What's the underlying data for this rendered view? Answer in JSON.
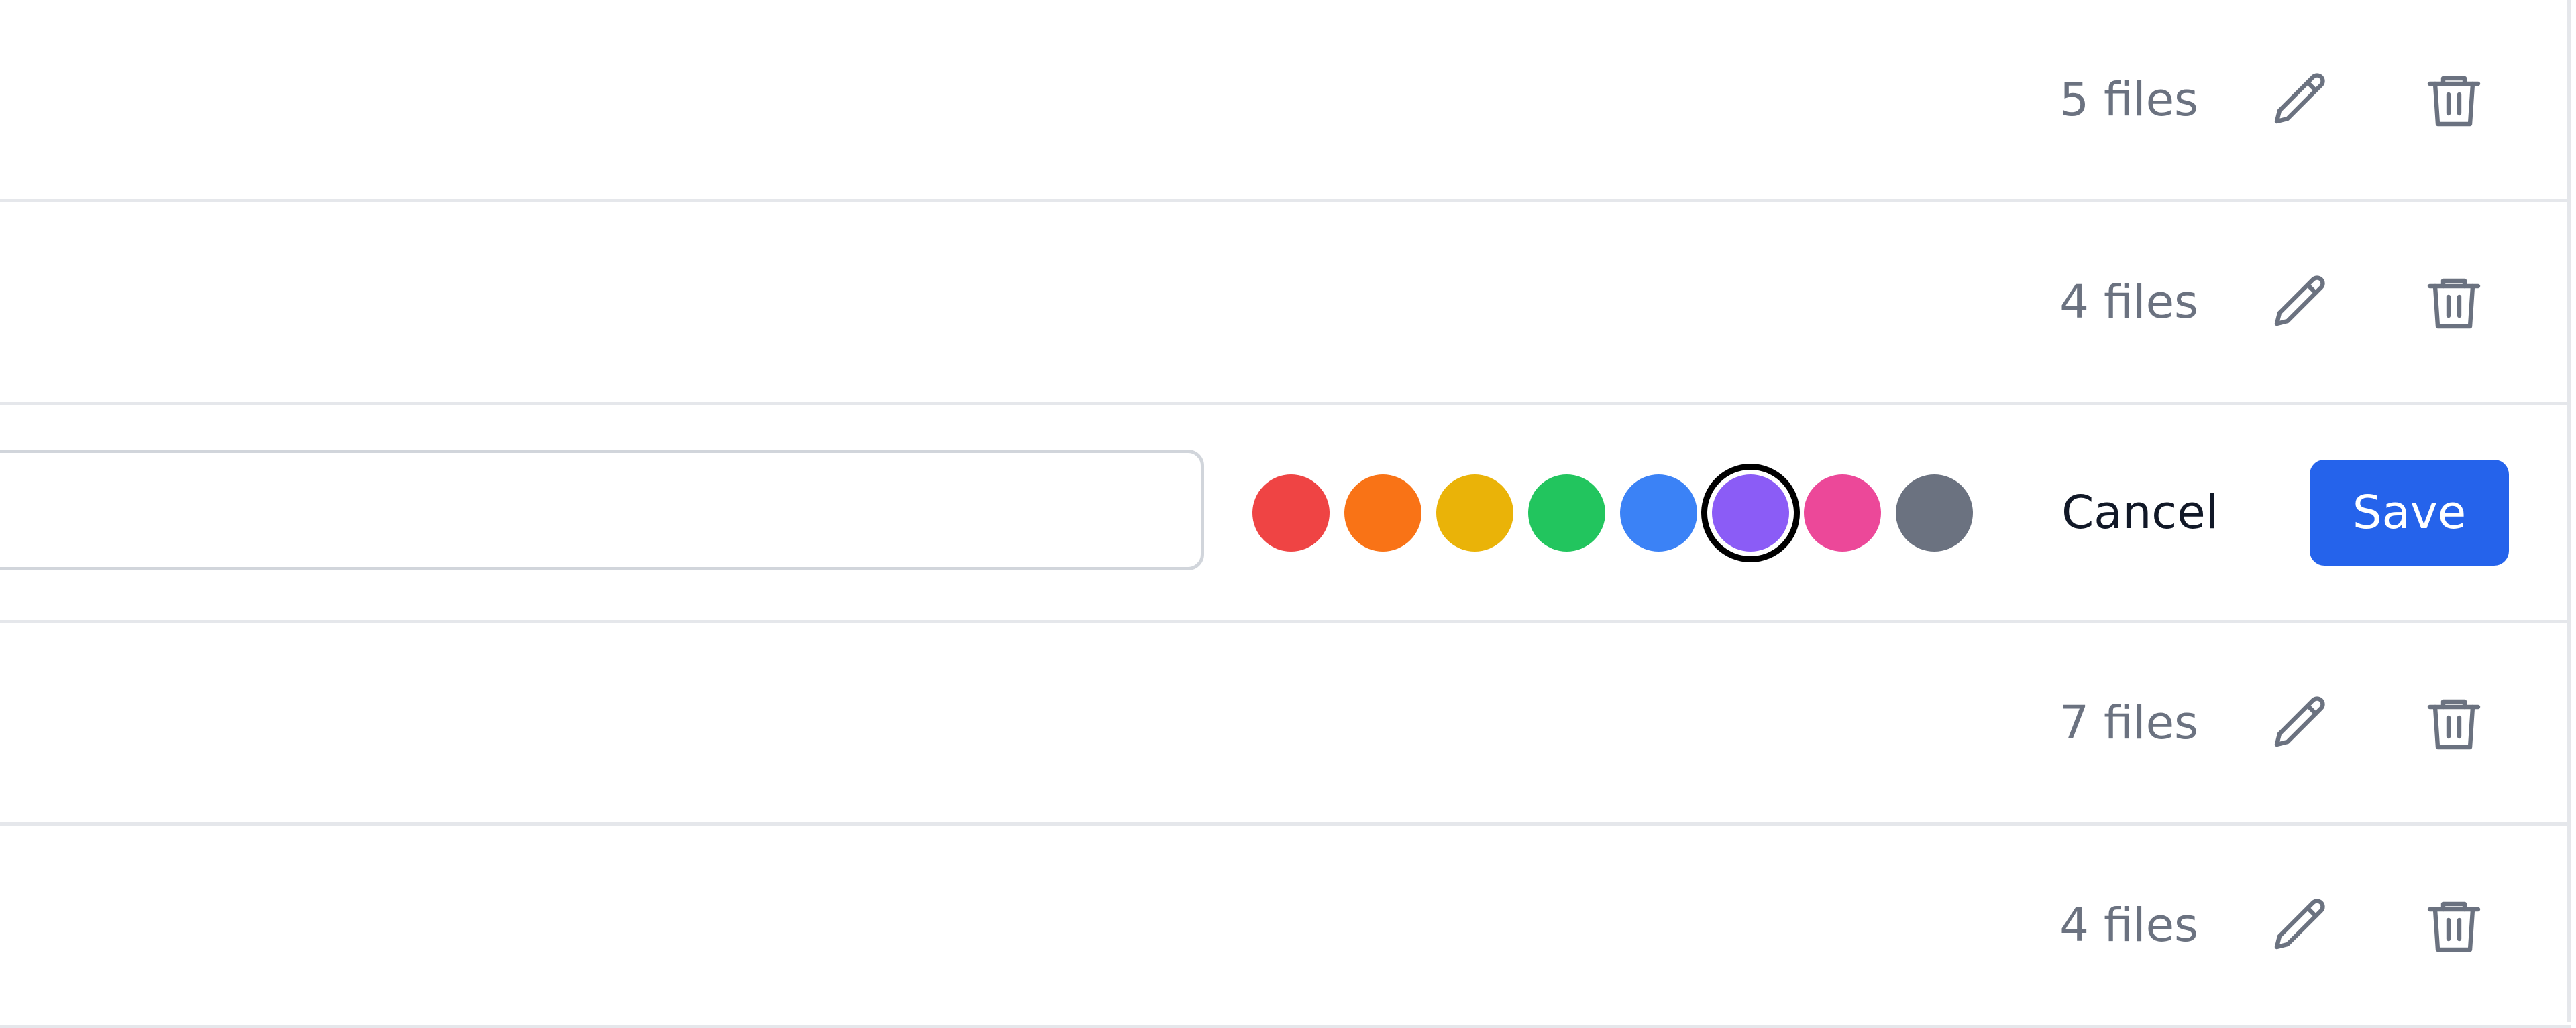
{
  "rows": [
    {
      "count": "5 files"
    },
    {
      "count": "4 files"
    },
    {
      "count": "7 files"
    },
    {
      "count": "4 files"
    }
  ],
  "edit_row": {
    "name_value": "",
    "colors": [
      "#ef4444",
      "#f97316",
      "#eab308",
      "#22c55e",
      "#3b82f6",
      "#8b5cf6",
      "#ec4899",
      "#6b7280"
    ],
    "selected_color": "#8b5cf6",
    "cancel_label": "Cancel",
    "save_label": "Save"
  },
  "icons": {
    "edit": "pencil-icon",
    "delete": "trash-icon"
  }
}
